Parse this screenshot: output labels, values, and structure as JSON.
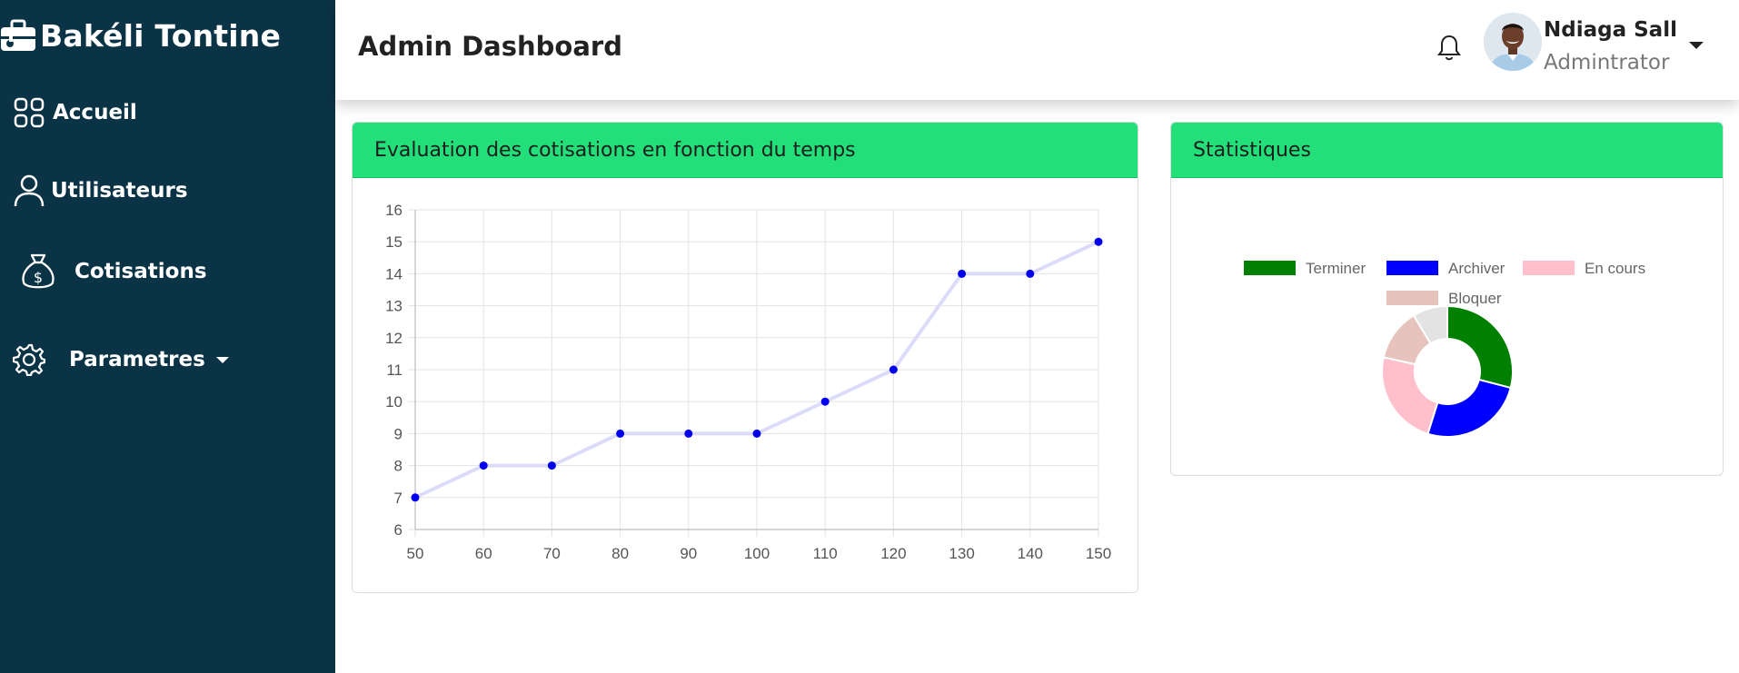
{
  "brand": {
    "name": "Bakéli Tontine",
    "icon": "briefcase-icon"
  },
  "sidebar": {
    "items": [
      {
        "label": "Accueil",
        "icon": "grid-icon"
      },
      {
        "label": "Utilisateurs",
        "icon": "user-icon"
      },
      {
        "label": "Cotisations",
        "icon": "money-bag-icon"
      },
      {
        "label": "Parametres",
        "icon": "gear-icon",
        "has_dropdown": true
      }
    ]
  },
  "header": {
    "title": "Admin Dashboard",
    "notification_icon": "bell-icon",
    "user": {
      "name": "Ndiaga Sall",
      "role": "Admintrator"
    }
  },
  "cards": {
    "line_title": "Evaluation des cotisations en fonction du temps",
    "stats_title": "Statistiques"
  },
  "colors": {
    "sidebar_bg": "#0b3346",
    "card_header": "#22df7a",
    "line_point": "#0000ee",
    "line_stroke": "#dcdcfa"
  },
  "chart_data": [
    {
      "type": "line",
      "x": [
        50,
        60,
        70,
        80,
        90,
        100,
        110,
        120,
        130,
        140,
        150
      ],
      "series": [
        {
          "values": [
            7,
            8,
            8,
            9,
            9,
            9,
            10,
            11,
            14,
            14,
            15
          ]
        }
      ],
      "xlim": [
        50,
        150
      ],
      "ylim": [
        6,
        16
      ],
      "xticks": [
        50,
        60,
        70,
        80,
        90,
        100,
        110,
        120,
        130,
        140,
        150
      ],
      "yticks": [
        6,
        7,
        8,
        9,
        10,
        11,
        12,
        13,
        14,
        15,
        16
      ],
      "grid": true,
      "legend": "none"
    },
    {
      "type": "pie",
      "donut": true,
      "labels": [
        "Terminer",
        "Archiver",
        "En cours",
        "Bloquer",
        ""
      ],
      "values": [
        27,
        24,
        22,
        12,
        8
      ],
      "colors": [
        "#008000",
        "#0000ff",
        "#ffc0cb",
        "#e6c3bd",
        "#e3e3e3"
      ],
      "legend": "top"
    }
  ]
}
